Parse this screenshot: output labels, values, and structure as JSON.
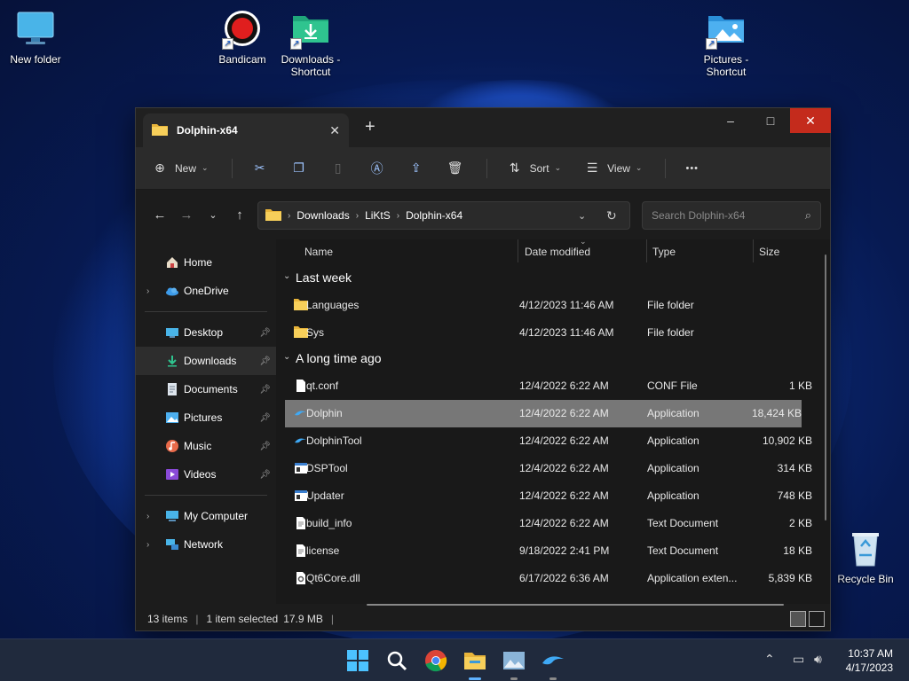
{
  "desktop": {
    "icons": [
      {
        "label": "New folder"
      },
      {
        "label": "Bandicam"
      },
      {
        "label_line1": "Downloads -",
        "label_line2": "Shortcut"
      },
      {
        "label_line1": "Pictures -",
        "label_line2": "Shortcut"
      },
      {
        "label": "Recycle Bin"
      }
    ]
  },
  "window": {
    "tab_title": "Dolphin-x64",
    "controls": {
      "minimize": "–",
      "maximize": "□",
      "close": "✕"
    }
  },
  "toolbar": {
    "new_label": "New",
    "sort_label": "Sort",
    "view_label": "View",
    "more_label": "•••"
  },
  "address": {
    "crumbs": [
      "Downloads",
      "LiKtS",
      "Dolphin-x64"
    ]
  },
  "search": {
    "placeholder": "Search Dolphin-x64"
  },
  "sidebar": {
    "items": [
      {
        "label": "Home"
      },
      {
        "label": "OneDrive"
      },
      {
        "label": "Desktop"
      },
      {
        "label": "Downloads"
      },
      {
        "label": "Documents"
      },
      {
        "label": "Pictures"
      },
      {
        "label": "Music"
      },
      {
        "label": "Videos"
      },
      {
        "label": "My Computer"
      },
      {
        "label": "Network"
      }
    ]
  },
  "columns": {
    "name": "Name",
    "date": "Date modified",
    "type": "Type",
    "size": "Size"
  },
  "groups": {
    "last_week": "Last week",
    "long_ago": "A long time ago"
  },
  "files": [
    {
      "name": "Languages",
      "date": "4/12/2023 11:46 AM",
      "type": "File folder",
      "size": ""
    },
    {
      "name": "Sys",
      "date": "4/12/2023 11:46 AM",
      "type": "File folder",
      "size": ""
    },
    {
      "name": "qt.conf",
      "date": "12/4/2022 6:22 AM",
      "type": "CONF File",
      "size": "1 KB"
    },
    {
      "name": "Dolphin",
      "date": "12/4/2022 6:22 AM",
      "type": "Application",
      "size": "18,424 KB"
    },
    {
      "name": "DolphinTool",
      "date": "12/4/2022 6:22 AM",
      "type": "Application",
      "size": "10,902 KB"
    },
    {
      "name": "DSPTool",
      "date": "12/4/2022 6:22 AM",
      "type": "Application",
      "size": "314 KB"
    },
    {
      "name": "Updater",
      "date": "12/4/2022 6:22 AM",
      "type": "Application",
      "size": "748 KB"
    },
    {
      "name": "build_info",
      "date": "12/4/2022 6:22 AM",
      "type": "Text Document",
      "size": "2 KB"
    },
    {
      "name": "license",
      "date": "9/18/2022 2:41 PM",
      "type": "Text Document",
      "size": "18 KB"
    },
    {
      "name": "Qt6Core.dll",
      "date": "6/17/2022 6:36 AM",
      "type": "Application exten...",
      "size": "5,839 KB"
    }
  ],
  "status": {
    "count": "13 items",
    "selected": "1 item selected",
    "size": "17.9 MB"
  },
  "taskbar": {
    "time": "10:37 AM",
    "date": "4/17/2023"
  }
}
